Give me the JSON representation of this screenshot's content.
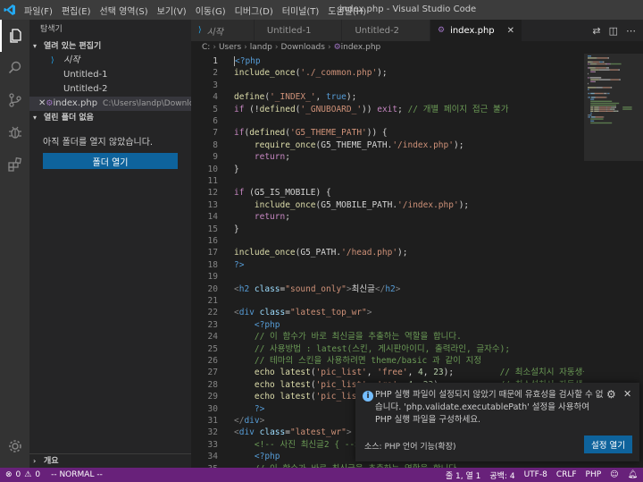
{
  "window": {
    "title": "index.php - Visual Studio Code"
  },
  "menu": [
    "파일(F)",
    "편집(E)",
    "선택 영역(S)",
    "보기(V)",
    "이동(G)",
    "디버그(D)",
    "터미널(T)",
    "도움말(H)"
  ],
  "activity": [
    {
      "icon": "files-icon"
    },
    {
      "icon": "search-icon"
    },
    {
      "icon": "source-control-icon"
    },
    {
      "icon": "debug-icon"
    },
    {
      "icon": "extensions-icon"
    }
  ],
  "sidebar": {
    "title": "탐색기",
    "open_editors_header": "열려 있는 편집기",
    "open_editors": [
      {
        "name": "시작",
        "path": "",
        "italic": true
      },
      {
        "name": "Untitled-1",
        "path": ""
      },
      {
        "name": "Untitled-2",
        "path": ""
      },
      {
        "name": "index.php",
        "path": "C:\\Users\\landp\\Downloa...",
        "active": true
      }
    ],
    "no_folder_header": "열린 폴더 없음",
    "no_folder_msg": "아직 폴더를 열지 않았습니다.",
    "open_folder_btn": "폴더 열기",
    "outline_header": "개요"
  },
  "tabs": [
    {
      "label": "시작",
      "italic": true
    },
    {
      "label": "Untitled-1"
    },
    {
      "label": "Untitled-2"
    },
    {
      "label": "index.php",
      "active": true
    }
  ],
  "breadcrumb": [
    "C:",
    "Users",
    "landp",
    "Downloads",
    "index.php"
  ],
  "code": [
    [
      [
        "<?php",
        "#569cd6"
      ]
    ],
    [
      [
        "include_once",
        "#dcdcaa"
      ],
      [
        "(",
        "#d4d4d4"
      ],
      [
        "'./_common.php'",
        "#ce9178"
      ],
      [
        ");",
        "#d4d4d4"
      ]
    ],
    [],
    [
      [
        "define",
        "#dcdcaa"
      ],
      [
        "(",
        "#d4d4d4"
      ],
      [
        "'_INDEX_'",
        "#ce9178"
      ],
      [
        ", ",
        "#d4d4d4"
      ],
      [
        "true",
        "#569cd6"
      ],
      [
        ");",
        "#d4d4d4"
      ]
    ],
    [
      [
        "if",
        "#c586c0"
      ],
      [
        " (!",
        "#d4d4d4"
      ],
      [
        "defined",
        "#dcdcaa"
      ],
      [
        "(",
        "#d4d4d4"
      ],
      [
        "'_GNUBOARD_'",
        "#ce9178"
      ],
      [
        ")) ",
        "#d4d4d4"
      ],
      [
        "exit",
        "#c586c0"
      ],
      [
        "; ",
        "#d4d4d4"
      ],
      [
        "// 개별 페이지 접근 불가",
        "#6a9955"
      ]
    ],
    [],
    [
      [
        "if",
        "#c586c0"
      ],
      [
        "(",
        "#d4d4d4"
      ],
      [
        "defined",
        "#dcdcaa"
      ],
      [
        "(",
        "#d4d4d4"
      ],
      [
        "'G5_THEME_PATH'",
        "#ce9178"
      ],
      [
        ")) {",
        "#d4d4d4"
      ]
    ],
    [
      [
        "    ",
        "#d4d4d4"
      ],
      [
        "require_once",
        "#dcdcaa"
      ],
      [
        "(G5_THEME_PATH.",
        "#d4d4d4"
      ],
      [
        "'/index.php'",
        "#ce9178"
      ],
      [
        ");",
        "#d4d4d4"
      ]
    ],
    [
      [
        "    ",
        "#d4d4d4"
      ],
      [
        "return",
        "#c586c0"
      ],
      [
        ";",
        "#d4d4d4"
      ]
    ],
    [
      [
        "}",
        "#d4d4d4"
      ]
    ],
    [],
    [
      [
        "if",
        "#c586c0"
      ],
      [
        " (G5_IS_MOBILE) {",
        "#d4d4d4"
      ]
    ],
    [
      [
        "    ",
        "#d4d4d4"
      ],
      [
        "include_once",
        "#dcdcaa"
      ],
      [
        "(G5_MOBILE_PATH.",
        "#d4d4d4"
      ],
      [
        "'/index.php'",
        "#ce9178"
      ],
      [
        ");",
        "#d4d4d4"
      ]
    ],
    [
      [
        "    ",
        "#d4d4d4"
      ],
      [
        "return",
        "#c586c0"
      ],
      [
        ";",
        "#d4d4d4"
      ]
    ],
    [
      [
        "}",
        "#d4d4d4"
      ]
    ],
    [],
    [
      [
        "include_once",
        "#dcdcaa"
      ],
      [
        "(G5_PATH.",
        "#d4d4d4"
      ],
      [
        "'/head.php'",
        "#ce9178"
      ],
      [
        ");",
        "#d4d4d4"
      ]
    ],
    [
      [
        "?>",
        "#569cd6"
      ]
    ],
    [],
    [
      [
        "<",
        "#808080"
      ],
      [
        "h2",
        "#569cd6"
      ],
      [
        " ",
        "#d4d4d4"
      ],
      [
        "class",
        "#9cdcfe"
      ],
      [
        "=",
        "#d4d4d4"
      ],
      [
        "\"sound_only\"",
        "#ce9178"
      ],
      [
        ">",
        "#808080"
      ],
      [
        "최신글",
        "#d4d4d4"
      ],
      [
        "</",
        "#808080"
      ],
      [
        "h2",
        "#569cd6"
      ],
      [
        ">",
        "#808080"
      ]
    ],
    [],
    [
      [
        "<",
        "#808080"
      ],
      [
        "div",
        "#569cd6"
      ],
      [
        " ",
        "#d4d4d4"
      ],
      [
        "class",
        "#9cdcfe"
      ],
      [
        "=",
        "#d4d4d4"
      ],
      [
        "\"latest_top_wr\"",
        "#ce9178"
      ],
      [
        ">",
        "#808080"
      ]
    ],
    [
      [
        "    ",
        "#d4d4d4"
      ],
      [
        "<?php",
        "#569cd6"
      ]
    ],
    [
      [
        "    ",
        "#d4d4d4"
      ],
      [
        "// 이 함수가 바로 최신글을 추출하는 역할을 합니다.",
        "#6a9955"
      ]
    ],
    [
      [
        "    ",
        "#d4d4d4"
      ],
      [
        "// 사용방법 : latest(스킨, 게시판아이디, 출력라인, 글자수);",
        "#6a9955"
      ]
    ],
    [
      [
        "    ",
        "#d4d4d4"
      ],
      [
        "// 테마의 스킨을 사용하려면 theme/basic 과 같이 지정",
        "#6a9955"
      ]
    ],
    [
      [
        "    ",
        "#d4d4d4"
      ],
      [
        "echo",
        "#dcdcaa"
      ],
      [
        " ",
        "#d4d4d4"
      ],
      [
        "latest",
        "#dcdcaa"
      ],
      [
        "(",
        "#d4d4d4"
      ],
      [
        "'pic_list'",
        "#ce9178"
      ],
      [
        ", ",
        "#d4d4d4"
      ],
      [
        "'free'",
        "#ce9178"
      ],
      [
        ", ",
        "#d4d4d4"
      ],
      [
        "4",
        "#b5cea8"
      ],
      [
        ", ",
        "#d4d4d4"
      ],
      [
        "23",
        "#b5cea8"
      ],
      [
        ");",
        "#d4d4d4"
      ],
      [
        "         // 최소설치시 자동생성",
        "#6a9955"
      ]
    ],
    [
      [
        "    ",
        "#d4d4d4"
      ],
      [
        "echo",
        "#dcdcaa"
      ],
      [
        " ",
        "#d4d4d4"
      ],
      [
        "latest",
        "#dcdcaa"
      ],
      [
        "(",
        "#d4d4d4"
      ],
      [
        "'pic_list'",
        "#ce9178"
      ],
      [
        ", ",
        "#d4d4d4"
      ],
      [
        "'qa'",
        "#ce9178"
      ],
      [
        ", ",
        "#d4d4d4"
      ],
      [
        "4",
        "#b5cea8"
      ],
      [
        ", ",
        "#d4d4d4"
      ],
      [
        "23",
        "#b5cea8"
      ],
      [
        ");",
        "#d4d4d4"
      ],
      [
        "           // 최소설치시 자동생성",
        "#6a9955"
      ]
    ],
    [
      [
        "    ",
        "#d4d4d4"
      ],
      [
        "echo",
        "#dcdcaa"
      ],
      [
        " ",
        "#d4d4d4"
      ],
      [
        "latest",
        "#dcdcaa"
      ],
      [
        "(",
        "#d4d4d4"
      ],
      [
        "'pic_list'",
        "#ce9178"
      ],
      [
        ", ",
        "#d4d4d4"
      ],
      [
        "'gallery'",
        "#ce9178"
      ],
      [
        ", ",
        "#d4d4d4"
      ],
      [
        "4",
        "#b5cea8"
      ],
      [
        ", ",
        "#d4d4d4"
      ],
      [
        "23",
        "#b5cea8"
      ],
      [
        ");",
        "#d4d4d4"
      ]
    ],
    [
      [
        "    ",
        "#d4d4d4"
      ],
      [
        "?>",
        "#569cd6"
      ]
    ],
    [
      [
        "</",
        "#808080"
      ],
      [
        "div",
        "#569cd6"
      ],
      [
        ">",
        "#808080"
      ]
    ],
    [
      [
        "<",
        "#808080"
      ],
      [
        "div",
        "#569cd6"
      ],
      [
        " ",
        "#d4d4d4"
      ],
      [
        "class",
        "#9cdcfe"
      ],
      [
        "=",
        "#d4d4d4"
      ],
      [
        "\"latest_wr\"",
        "#ce9178"
      ],
      [
        ">",
        "#808080"
      ]
    ],
    [
      [
        "    ",
        "#d4d4d4"
      ],
      [
        "<!-- 사진 최신글2 { -->",
        "#6a9955"
      ]
    ],
    [
      [
        "    ",
        "#d4d4d4"
      ],
      [
        "<?php",
        "#569cd6"
      ]
    ],
    [
      [
        "    ",
        "#d4d4d4"
      ],
      [
        "// 이 함수가 바로 최신글을 추출하는 역할을 합니다.",
        "#6a9955"
      ]
    ]
  ],
  "notification": {
    "message": "PHP 실행 파일이 설정되지 않았기 때문에 유효성을 검사할 수 없습니다. 'php.validate.executablePath' 설정을 사용하여 PHP 실행 파일을 구성하세요.",
    "source": "소스: PHP 언어 기능(확장)",
    "button": "설정 열기"
  },
  "status": {
    "errors": "0",
    "warnings": "0",
    "mode": "-- NORMAL --",
    "position": "줄 1, 열 1",
    "spaces": "공백: 4",
    "encoding": "UTF-8",
    "eol": "CRLF",
    "language": "PHP"
  },
  "colors": {
    "accent": "#0e639c",
    "statusbar": "#68217a",
    "vscode_blue": "#23a9f2"
  }
}
